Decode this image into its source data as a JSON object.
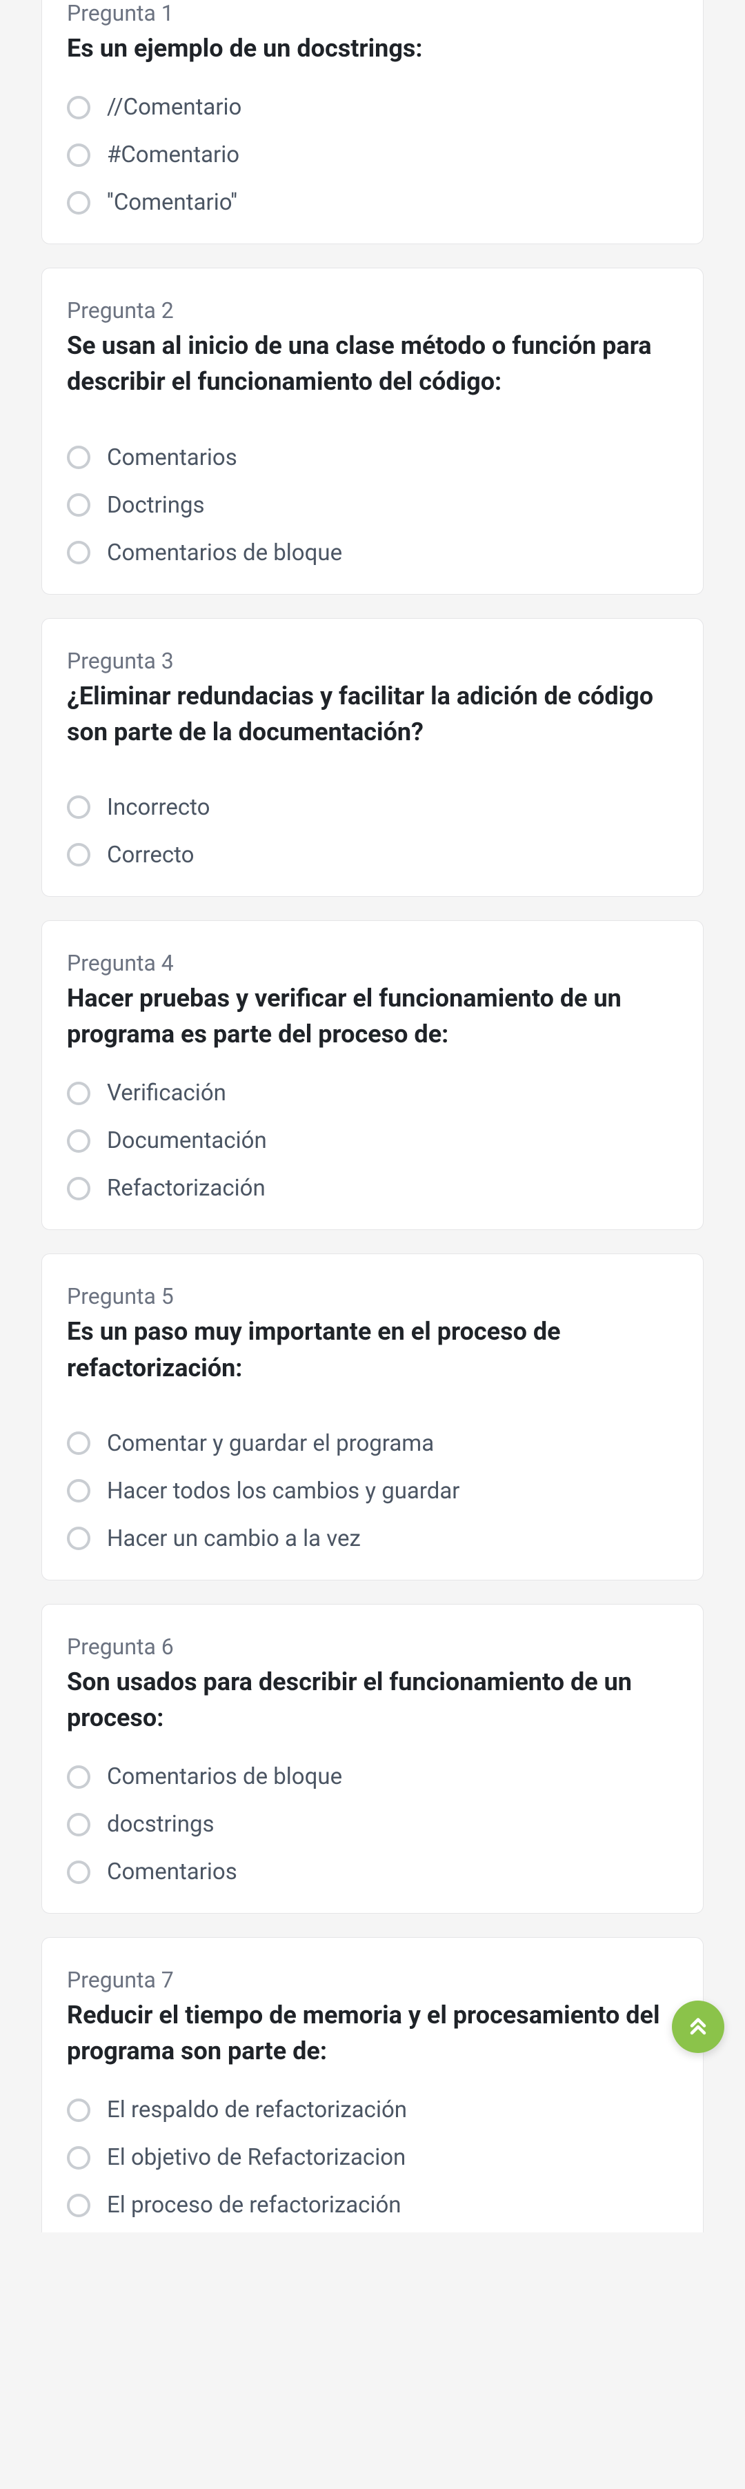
{
  "questions": [
    {
      "number": "Pregunta 1",
      "text": "Es un ejemplo de un docstrings:",
      "gap": "small",
      "options": [
        "//Comentario",
        "#Comentario",
        "''Comentario''"
      ]
    },
    {
      "number": "Pregunta 2",
      "text": "Se usan al inicio de una clase método o función para describir el funcionamiento del código:",
      "gap": "large",
      "options": [
        "Comentarios",
        "Doctrings",
        "Comentarios de bloque"
      ]
    },
    {
      "number": "Pregunta 3",
      "text": "¿Eliminar redundacias y facilitar la adición de código son parte de la documentación?",
      "gap": "large",
      "options": [
        "Incorrecto",
        "Correcto"
      ]
    },
    {
      "number": "Pregunta 4",
      "text": "Hacer pruebas y verificar el funcionamiento de un programa es parte del proceso de:",
      "gap": "small",
      "options": [
        "Verificación",
        "Documentación",
        "Refactorización"
      ]
    },
    {
      "number": "Pregunta 5",
      "text": "Es un paso muy importante en el proceso de refactorización:",
      "gap": "large",
      "options": [
        "Comentar y guardar el programa",
        "Hacer todos los cambios y guardar",
        "Hacer un cambio a la vez"
      ]
    },
    {
      "number": "Pregunta 6",
      "text": "Son usados para describir el funcionamiento de un proceso:",
      "gap": "small",
      "options": [
        "Comentarios de bloque",
        "docstrings",
        "Comentarios"
      ]
    },
    {
      "number": "Pregunta 7",
      "text": "Reducir el tiempo de memoria y el procesamiento del programa son parte de:",
      "gap": "small",
      "options": [
        "El respaldo de refactorización",
        "El objetivo de Refactorizacion",
        "El proceso de refactorización"
      ]
    }
  ]
}
